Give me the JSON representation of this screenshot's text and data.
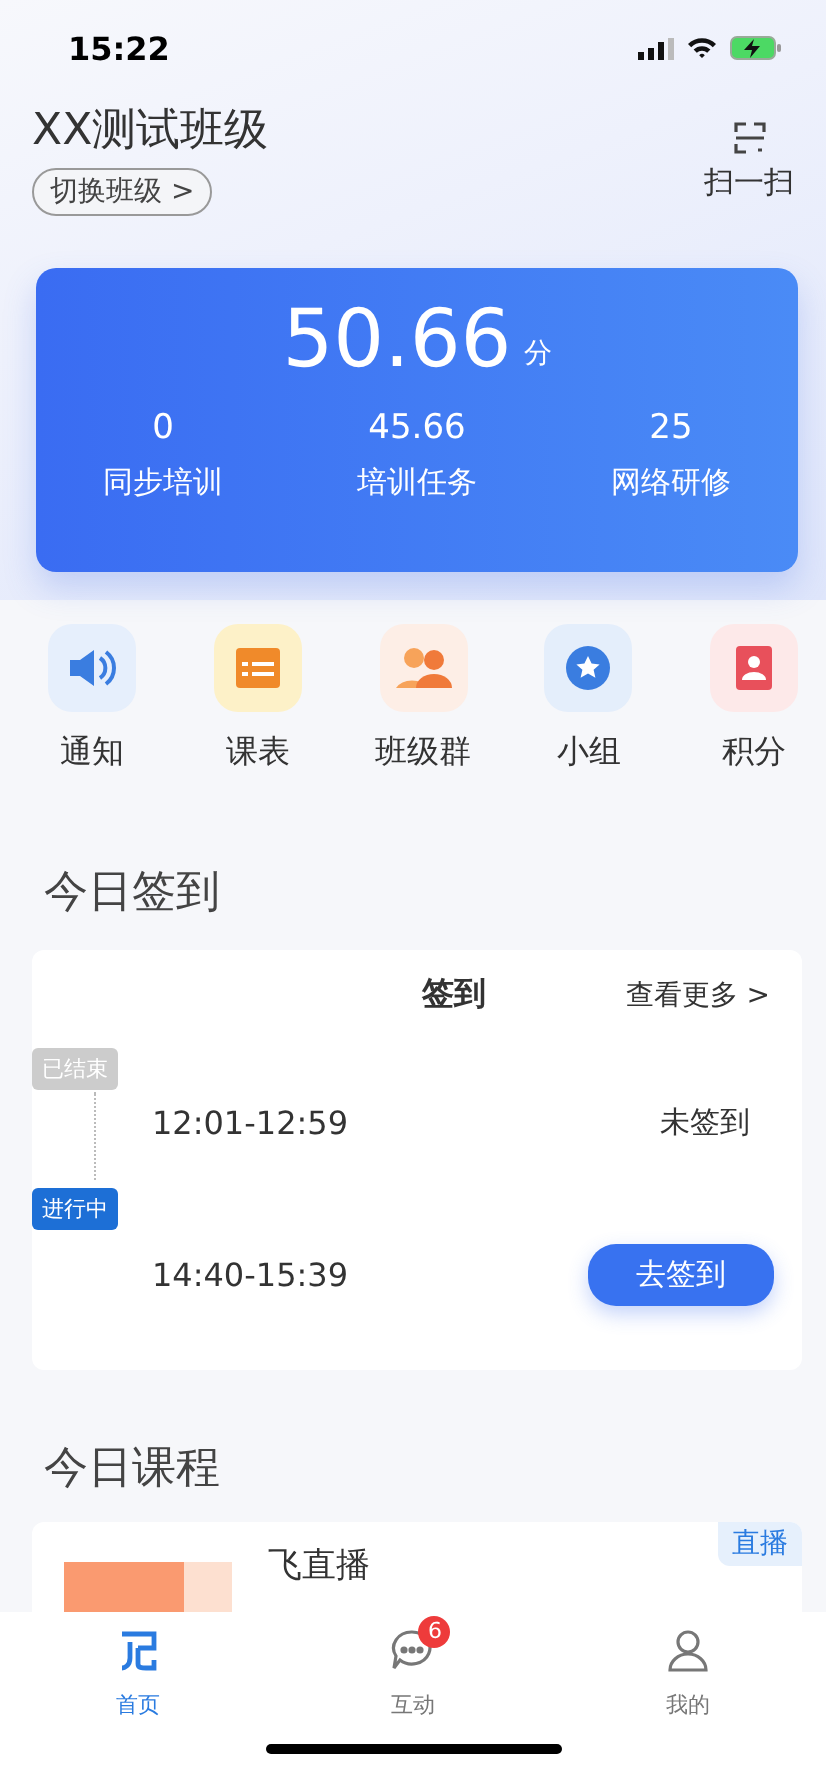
{
  "status_bar": {
    "time": "15:22"
  },
  "header": {
    "title": "XX测试班级",
    "switch_button": "切换班级 >",
    "scan_label": "扫一扫"
  },
  "score_card": {
    "score": "50.66",
    "unit": "分",
    "stats": [
      {
        "value": "0",
        "label": "同步培训"
      },
      {
        "value": "45.66",
        "label": "培训任务"
      },
      {
        "value": "25",
        "label": "网络研修"
      }
    ]
  },
  "shortcuts": [
    {
      "kind": "notice",
      "label": "通知"
    },
    {
      "kind": "schedule",
      "label": "课表"
    },
    {
      "kind": "group-chat",
      "label": "班级群"
    },
    {
      "kind": "team",
      "label": "小组"
    },
    {
      "kind": "points",
      "label": "积分"
    }
  ],
  "checkin": {
    "section_title": "今日签到",
    "heading": "签到",
    "more_link": "查看更多 >",
    "sessions": [
      {
        "kind": "ended",
        "status": "已结束",
        "time": "12:01-12:59",
        "action": "未签到"
      },
      {
        "kind": "ongoing",
        "status": "进行中",
        "time": "14:40-15:39",
        "action": "去签到"
      }
    ]
  },
  "courses": {
    "section_title": "今日课程",
    "items": [
      {
        "title": "飞直播",
        "tag": "直播"
      }
    ]
  },
  "tab_bar": [
    {
      "kind": "home",
      "label": "首页",
      "selected": true
    },
    {
      "kind": "chat",
      "label": "互动",
      "selected": false,
      "badge": "6"
    },
    {
      "kind": "profile",
      "label": "我的",
      "selected": false
    }
  ]
}
